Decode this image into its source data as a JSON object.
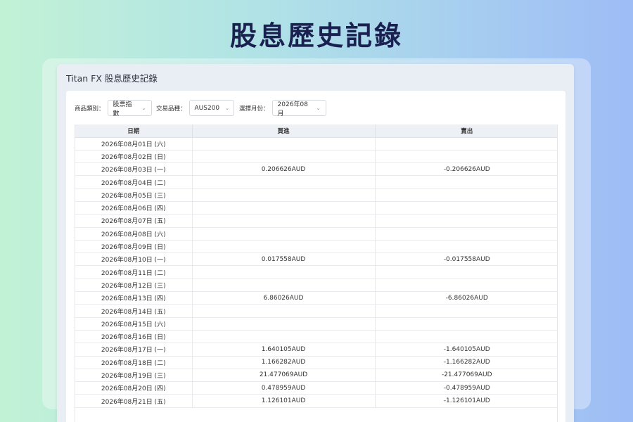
{
  "hero_title": "股息歷史記錄",
  "panel_title": "Titan FX 股息歷史記錄",
  "filters": [
    {
      "label": "商品類別：",
      "value": "股票指數"
    },
    {
      "label": "交易品種：",
      "value": "AUS200"
    },
    {
      "label": "選擇月份：",
      "value": "2026年08月"
    }
  ],
  "table": {
    "headers": [
      "日期",
      "買進",
      "賣出"
    ],
    "rows": [
      [
        "2026年08月01日 (六)",
        "",
        ""
      ],
      [
        "2026年08月02日 (日)",
        "",
        ""
      ],
      [
        "2026年08月03日 (一)",
        "0.206626AUD",
        "-0.206626AUD"
      ],
      [
        "2026年08月04日 (二)",
        "",
        ""
      ],
      [
        "2026年08月05日 (三)",
        "",
        ""
      ],
      [
        "2026年08月06日 (四)",
        "",
        ""
      ],
      [
        "2026年08月07日 (五)",
        "",
        ""
      ],
      [
        "2026年08月08日 (六)",
        "",
        ""
      ],
      [
        "2026年08月09日 (日)",
        "",
        ""
      ],
      [
        "2026年08月10日 (一)",
        "0.017558AUD",
        "-0.017558AUD"
      ],
      [
        "2026年08月11日 (二)",
        "",
        ""
      ],
      [
        "2026年08月12日 (三)",
        "",
        ""
      ],
      [
        "2026年08月13日 (四)",
        "6.86026AUD",
        "-6.86026AUD"
      ],
      [
        "2026年08月14日 (五)",
        "",
        ""
      ],
      [
        "2026年08月15日 (六)",
        "",
        ""
      ],
      [
        "2026年08月16日 (日)",
        "",
        ""
      ],
      [
        "2026年08月17日 (一)",
        "1.640105AUD",
        "-1.640105AUD"
      ],
      [
        "2026年08月18日 (二)",
        "1.166282AUD",
        "-1.166282AUD"
      ],
      [
        "2026年08月19日 (三)",
        "21.477069AUD",
        "-21.477069AUD"
      ],
      [
        "2026年08月20日 (四)",
        "0.478959AUD",
        "-0.478959AUD"
      ],
      [
        "2026年08月21日 (五)",
        "1.126101AUD",
        "-1.126101AUD"
      ]
    ]
  }
}
